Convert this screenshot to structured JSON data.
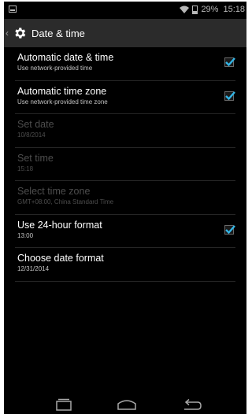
{
  "status_bar": {
    "battery_text": "29%",
    "time": "15:18"
  },
  "action_bar": {
    "title": "Date & time"
  },
  "settings": [
    {
      "title": "Automatic date & time",
      "summary": "Use network-provided time",
      "checked": true,
      "enabled": true
    },
    {
      "title": "Automatic time zone",
      "summary": "Use network-provided time zone",
      "checked": true,
      "enabled": true
    },
    {
      "title": "Set date",
      "summary": "10/8/2014",
      "enabled": false
    },
    {
      "title": "Set time",
      "summary": "15:18",
      "enabled": false
    },
    {
      "title": "Select time zone",
      "summary": "GMT+08:00, China Standard Time",
      "enabled": false
    },
    {
      "title": "Use 24-hour format",
      "summary": "13:00",
      "checked": true,
      "enabled": true
    },
    {
      "title": "Choose date format",
      "summary": "12/31/2014",
      "enabled": true
    }
  ],
  "colors": {
    "accent": "#33b5e5",
    "background": "#000000",
    "action_bar": "#2b2b2b",
    "disabled_text": "#4d4d4d"
  }
}
